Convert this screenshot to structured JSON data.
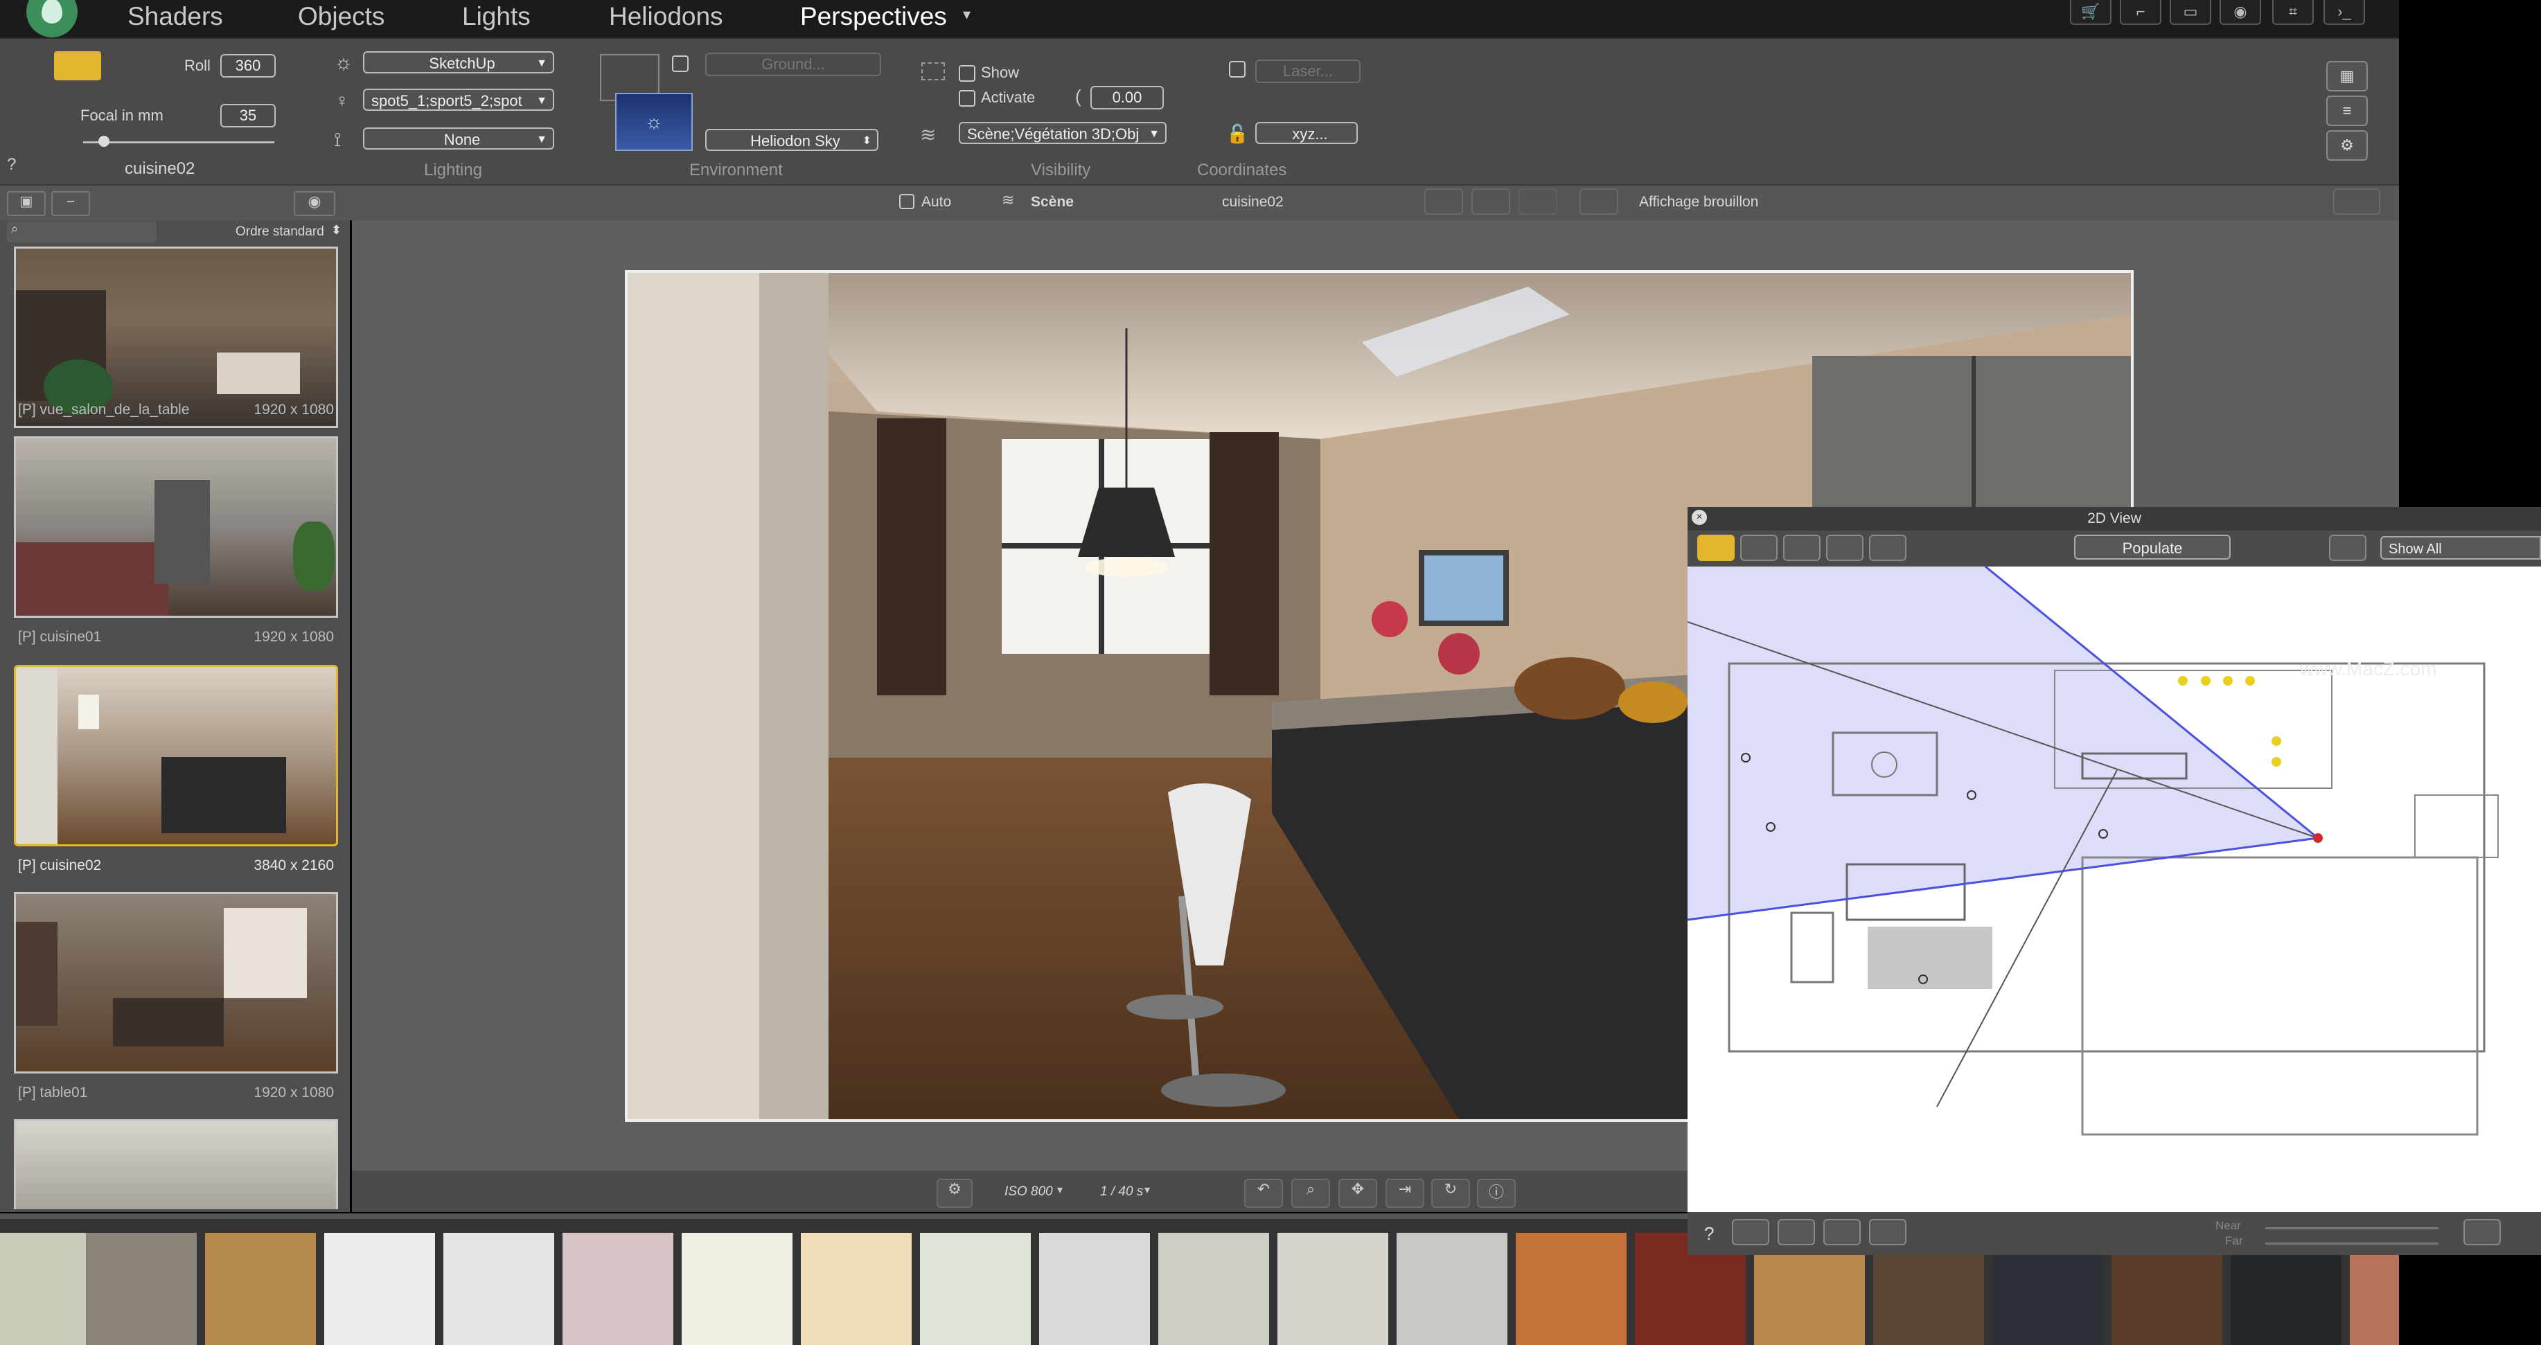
{
  "menu": {
    "items": [
      "Shaders",
      "Objects",
      "Lights",
      "Heliodons",
      "Perspectives"
    ],
    "active_index": 4
  },
  "camera": {
    "roll_label": "Roll",
    "roll_value": "360",
    "focal_label": "Focal in mm",
    "focal_value": "35",
    "name": "cuisine02"
  },
  "lighting": {
    "group_label": "Lighting",
    "sun_source": "SketchUp",
    "spots": "spot5_1;sport5_2;spot",
    "shadow": "None"
  },
  "environment": {
    "group_label": "Environment",
    "ground_placeholder": "Ground...",
    "sky": "Heliodon Sky"
  },
  "visibility": {
    "group_label": "Visibility",
    "show_label": "Show",
    "activate_label": "Activate",
    "value": "0.00",
    "layers": "Scène;Végétation 3D;Obj"
  },
  "coordinates": {
    "group_label": "Coordinates",
    "laser_placeholder": "Laser...",
    "xyz": "xyz..."
  },
  "subbar": {
    "auto_label": "Auto",
    "scene_label": "Scène",
    "view_name": "cuisine02",
    "draft_label": "Affichage brouillon"
  },
  "left_panel": {
    "help": "?",
    "sort_label": "Ordre standard",
    "thumbnails": [
      {
        "caption": "[P] vue_salon_de_la_table",
        "resolution": "1920 x 1080",
        "selected": false
      },
      {
        "caption": "[P] cuisine01",
        "resolution": "1920 x 1080",
        "selected": false
      },
      {
        "caption": "[P] cuisine02",
        "resolution": "3840 x 2160",
        "selected": true
      },
      {
        "caption": "[P] table01",
        "resolution": "1920 x 1080",
        "selected": false
      }
    ]
  },
  "bottom_bar": {
    "iso": "ISO 800",
    "shutter": "1 / 40 s"
  },
  "view2d": {
    "title": "2D View",
    "populate": "Populate",
    "show_select": "Show All",
    "help": "?",
    "near_label": "Near",
    "far_label": "Far",
    "watermark": "www.MacZ.com"
  },
  "colors": {
    "accent": "#e4b62c",
    "panel": "#4a4a4a",
    "plan_highlight": "#cfd2f7",
    "camera_dot": "#d12a2a"
  }
}
